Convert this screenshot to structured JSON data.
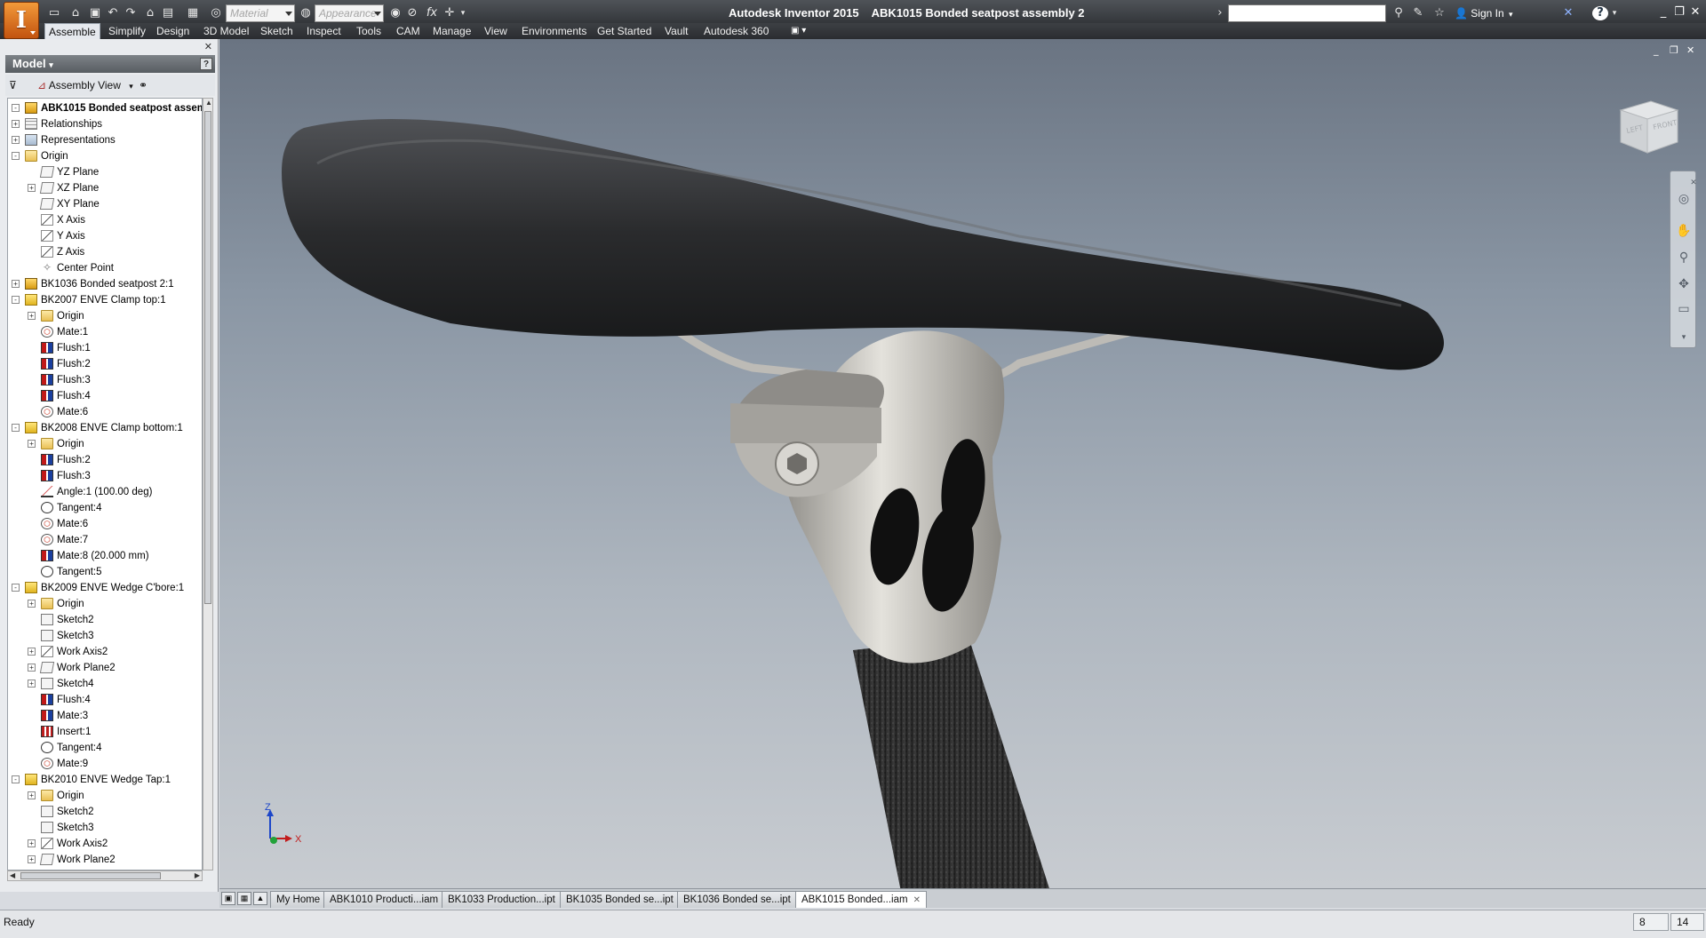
{
  "app": {
    "name": "Autodesk Inventor 2015",
    "document": "ABK1015 Bonded seatpost assembly 2"
  },
  "quick_access": {
    "material_placeholder": "Material",
    "appearance_placeholder": "Appearance",
    "fx_label": "fx",
    "sign_in": "Sign In",
    "help_label": "?"
  },
  "ribbon": {
    "tabs": [
      "Assemble",
      "Simplify",
      "Design",
      "3D Model",
      "Sketch",
      "Inspect",
      "Tools",
      "CAM",
      "Manage",
      "View",
      "Environments",
      "Get Started",
      "Vault",
      "Autodesk 360"
    ],
    "active_tab": "Assemble"
  },
  "browser": {
    "title": "Model",
    "view_label": "Assembly View",
    "help": "?",
    "close": "✕",
    "tree": [
      {
        "label": "ABK1015 Bonded seatpost assembly 2",
        "icon": "assy-icon",
        "indent": 0,
        "exp": "-",
        "root": true
      },
      {
        "label": "Relationships",
        "icon": "rel-icon",
        "indent": 0,
        "exp": "+"
      },
      {
        "label": "Representations",
        "icon": "rep-icon",
        "indent": 0,
        "exp": "+"
      },
      {
        "label": "Origin",
        "icon": "folder-icon",
        "indent": 0,
        "exp": "-"
      },
      {
        "label": "YZ Plane",
        "icon": "plane-icon",
        "indent": 1,
        "exp": ""
      },
      {
        "label": "XZ Plane",
        "icon": "plane-icon",
        "indent": 1,
        "exp": "+"
      },
      {
        "label": "XY Plane",
        "icon": "plane-icon",
        "indent": 1,
        "exp": ""
      },
      {
        "label": "X Axis",
        "icon": "axis-icon",
        "indent": 1,
        "exp": ""
      },
      {
        "label": "Y Axis",
        "icon": "axis-icon",
        "indent": 1,
        "exp": ""
      },
      {
        "label": "Z Axis",
        "icon": "axis-icon",
        "indent": 1,
        "exp": ""
      },
      {
        "label": "Center Point",
        "icon": "point-icon",
        "indent": 1,
        "exp": ""
      },
      {
        "label": "BK1036 Bonded seatpost 2:1",
        "icon": "assy-icon",
        "indent": 0,
        "exp": "+"
      },
      {
        "label": "BK2007 ENVE Clamp top:1",
        "icon": "part-icon",
        "indent": 0,
        "exp": "-"
      },
      {
        "label": "Origin",
        "icon": "folder-icon",
        "indent": 1,
        "exp": "+"
      },
      {
        "label": "Mate:1",
        "icon": "mate-icon",
        "indent": 1,
        "exp": ""
      },
      {
        "label": "Flush:1",
        "icon": "flush-icon",
        "indent": 1,
        "exp": ""
      },
      {
        "label": "Flush:2",
        "icon": "flush-icon",
        "indent": 1,
        "exp": ""
      },
      {
        "label": "Flush:3",
        "icon": "flush-icon",
        "indent": 1,
        "exp": ""
      },
      {
        "label": "Flush:4",
        "icon": "flush-icon",
        "indent": 1,
        "exp": ""
      },
      {
        "label": "Mate:6",
        "icon": "mate-icon",
        "indent": 1,
        "exp": ""
      },
      {
        "label": "BK2008 ENVE Clamp bottom:1",
        "icon": "part-icon",
        "indent": 0,
        "exp": "-"
      },
      {
        "label": "Origin",
        "icon": "folder-icon",
        "indent": 1,
        "exp": "+"
      },
      {
        "label": "Flush:2",
        "icon": "flush-icon",
        "indent": 1,
        "exp": ""
      },
      {
        "label": "Flush:3",
        "icon": "flush-icon",
        "indent": 1,
        "exp": ""
      },
      {
        "label": "Angle:1 (100.00 deg)",
        "icon": "angle-icon",
        "indent": 1,
        "exp": ""
      },
      {
        "label": "Tangent:4",
        "icon": "tangent-icon",
        "indent": 1,
        "exp": ""
      },
      {
        "label": "Mate:6",
        "icon": "mate-icon",
        "indent": 1,
        "exp": ""
      },
      {
        "label": "Mate:7",
        "icon": "mate-icon",
        "indent": 1,
        "exp": ""
      },
      {
        "label": "Mate:8 (20.000 mm)",
        "icon": "flush-icon",
        "indent": 1,
        "exp": ""
      },
      {
        "label": "Tangent:5",
        "icon": "tangent-icon",
        "indent": 1,
        "exp": ""
      },
      {
        "label": "BK2009 ENVE Wedge C'bore:1",
        "icon": "part-icon",
        "indent": 0,
        "exp": "-"
      },
      {
        "label": "Origin",
        "icon": "folder-icon",
        "indent": 1,
        "exp": "+"
      },
      {
        "label": "Sketch2",
        "icon": "sketch-icon",
        "indent": 1,
        "exp": ""
      },
      {
        "label": "Sketch3",
        "icon": "sketch-icon",
        "indent": 1,
        "exp": ""
      },
      {
        "label": "Work Axis2",
        "icon": "axis-icon",
        "indent": 1,
        "exp": "+"
      },
      {
        "label": "Work Plane2",
        "icon": "plane-icon",
        "indent": 1,
        "exp": "+"
      },
      {
        "label": "Sketch4",
        "icon": "sketch-icon",
        "indent": 1,
        "exp": "+"
      },
      {
        "label": "Flush:4",
        "icon": "flush-icon",
        "indent": 1,
        "exp": ""
      },
      {
        "label": "Mate:3",
        "icon": "flush-icon",
        "indent": 1,
        "exp": ""
      },
      {
        "label": "Insert:1",
        "icon": "insert-icon",
        "indent": 1,
        "exp": ""
      },
      {
        "label": "Tangent:4",
        "icon": "tangent-icon",
        "indent": 1,
        "exp": ""
      },
      {
        "label": "Mate:9",
        "icon": "mate-icon",
        "indent": 1,
        "exp": ""
      },
      {
        "label": "BK2010 ENVE Wedge Tap:1",
        "icon": "part-icon",
        "indent": 0,
        "exp": "-"
      },
      {
        "label": "Origin",
        "icon": "folder-icon",
        "indent": 1,
        "exp": "+"
      },
      {
        "label": "Sketch2",
        "icon": "sketch-icon",
        "indent": 1,
        "exp": ""
      },
      {
        "label": "Sketch3",
        "icon": "sketch-icon",
        "indent": 1,
        "exp": ""
      },
      {
        "label": "Work Axis2",
        "icon": "axis-icon",
        "indent": 1,
        "exp": "+"
      },
      {
        "label": "Work Plane2",
        "icon": "plane-icon",
        "indent": 1,
        "exp": "+"
      }
    ]
  },
  "viewport": {
    "viewcube_left": "LEFT",
    "viewcube_front": "FRONT",
    "triad": {
      "z": "Z",
      "x": "X"
    }
  },
  "doc_tabs": [
    {
      "label": "My Home",
      "active": false
    },
    {
      "label": "ABK1010 Producti...iam",
      "active": false
    },
    {
      "label": "BK1033 Production...ipt",
      "active": false
    },
    {
      "label": "BK1035 Bonded se...ipt",
      "active": false
    },
    {
      "label": "BK1036 Bonded se...ipt",
      "active": false
    },
    {
      "label": "ABK1015 Bonded...iam",
      "active": true
    }
  ],
  "status": {
    "text": "Ready",
    "count_a": "8",
    "count_b": "14"
  },
  "colors": {
    "accent": "#d46a1a",
    "viewport_top": "#6a7482",
    "viewport_bottom": "#c8ccd1",
    "saddle": "#2b2c2e",
    "metal": "#c9c7c2"
  }
}
